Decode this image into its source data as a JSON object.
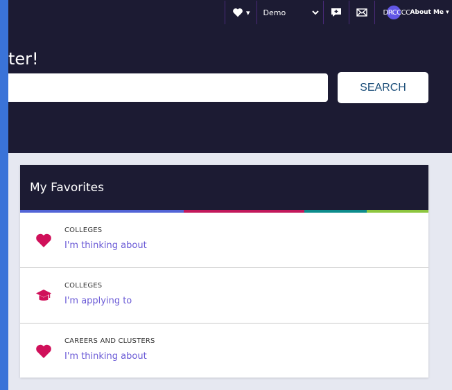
{
  "topbar": {
    "favorites_caret": "▾",
    "profile_select": "Demo",
    "initials": "DRCCCC",
    "about_me": "About Me ▾"
  },
  "hero": {
    "heading": "ter!",
    "search_value": "",
    "search_button": "SEARCH"
  },
  "favorites": {
    "title": "My Favorites",
    "stripe_colors": [
      "#5264d6",
      "#c2185b",
      "#0d8c8c",
      "#8dc63f"
    ],
    "items": [
      {
        "category": "COLLEGES",
        "link": "I'm thinking about",
        "icon": "heart-icon"
      },
      {
        "category": "COLLEGES",
        "link": "I'm applying to",
        "icon": "graduation-cap-icon"
      },
      {
        "category": "CAREERS AND CLUSTERS",
        "link": "I'm thinking about",
        "icon": "heart-icon"
      }
    ]
  },
  "colors": {
    "header_bg": "#1c1b33",
    "accent_pink": "#d0105a",
    "link_purple": "#6a5ad6",
    "page_bg": "#e6e8f1"
  }
}
